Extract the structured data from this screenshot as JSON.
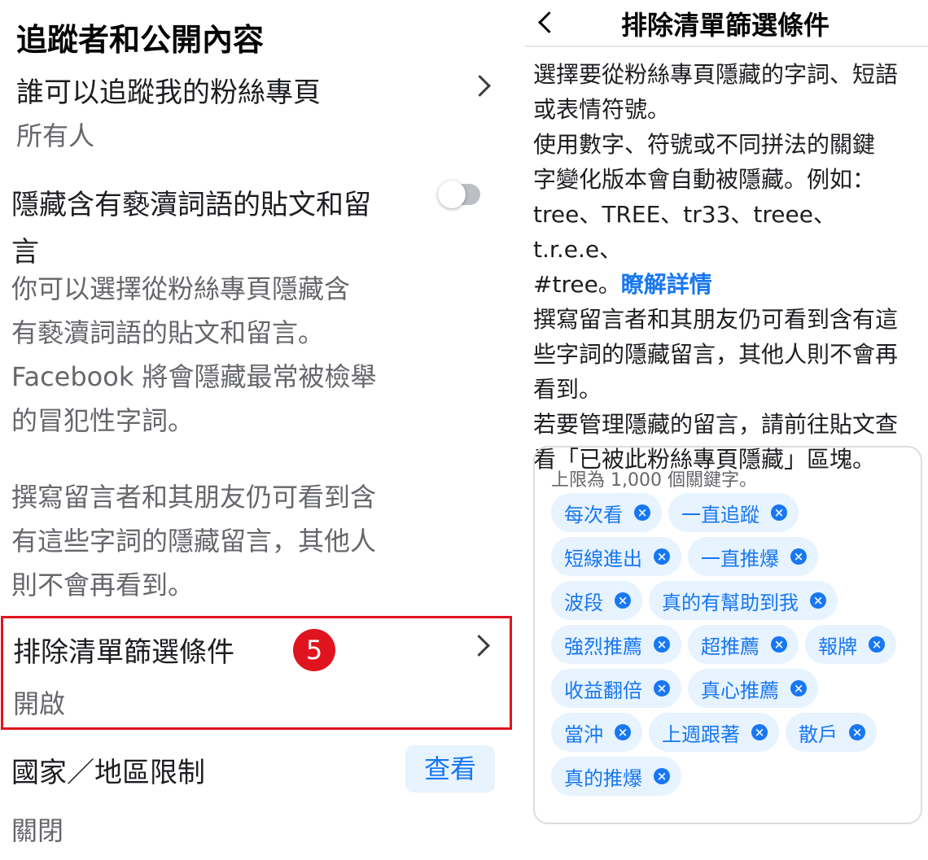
{
  "left": {
    "heading": "追蹤者和公開內容",
    "follow": {
      "title": "誰可以追蹤我的粉絲專頁",
      "value": "所有人"
    },
    "hide_profanity": {
      "title_line1": "隱藏含有褻瀆詞語的貼文和留",
      "title_line2": "言",
      "toggle_on": false,
      "desc_lines": [
        "你可以選擇從粉絲專頁隱藏含",
        "有褻瀆詞語的貼文和留言。",
        "Facebook 將會隱藏最常被檢舉",
        "的冒犯性字詞。"
      ]
    },
    "hidden_note_lines": [
      "撰寫留言者和其朋友仍可看到含",
      "有這些字詞的隱藏留言，其他人",
      "則不會再看到。"
    ],
    "blocklist": {
      "title": "排除清單篩選條件",
      "value": "開啟",
      "badge": "5"
    },
    "country": {
      "title": "國家／地區限制",
      "button": "查看",
      "value": "關閉"
    },
    "colors": {
      "highlight": "#e0141e",
      "accent": "#1877f2"
    }
  },
  "right": {
    "title": "排除清單篩選條件",
    "lines": [
      "選擇要從粉絲專頁隱藏的字詞、短語",
      "或表情符號。",
      "使用數字、符號或不同拼法的關鍵",
      "字變化版本會自動被隱藏。例如：",
      "tree、TREE、tr33、treee、t.r.e.e、"
    ],
    "line6_prefix": "#tree。",
    "learn_more": "瞭解詳情",
    "lines2": [
      "撰寫留言者和其朋友仍可看到含有這",
      "些字詞的隱藏留言，其他人則不會再",
      "看到。",
      "若要管理隱藏的留言，請前往貼文查",
      "看「已被此粉絲專頁隱藏」區塊。"
    ],
    "limit_text": "上限為 1,000 個關鍵字。",
    "keywords": [
      "每次看",
      "一直追蹤",
      "短線進出",
      "一直推爆",
      "波段",
      "真的有幫助到我",
      "強烈推薦",
      "超推薦",
      "報牌",
      "收益翻倍",
      "真心推薦",
      "當沖",
      "上週跟著",
      "散戶",
      "真的推爆"
    ],
    "remove_glyph": "×"
  }
}
